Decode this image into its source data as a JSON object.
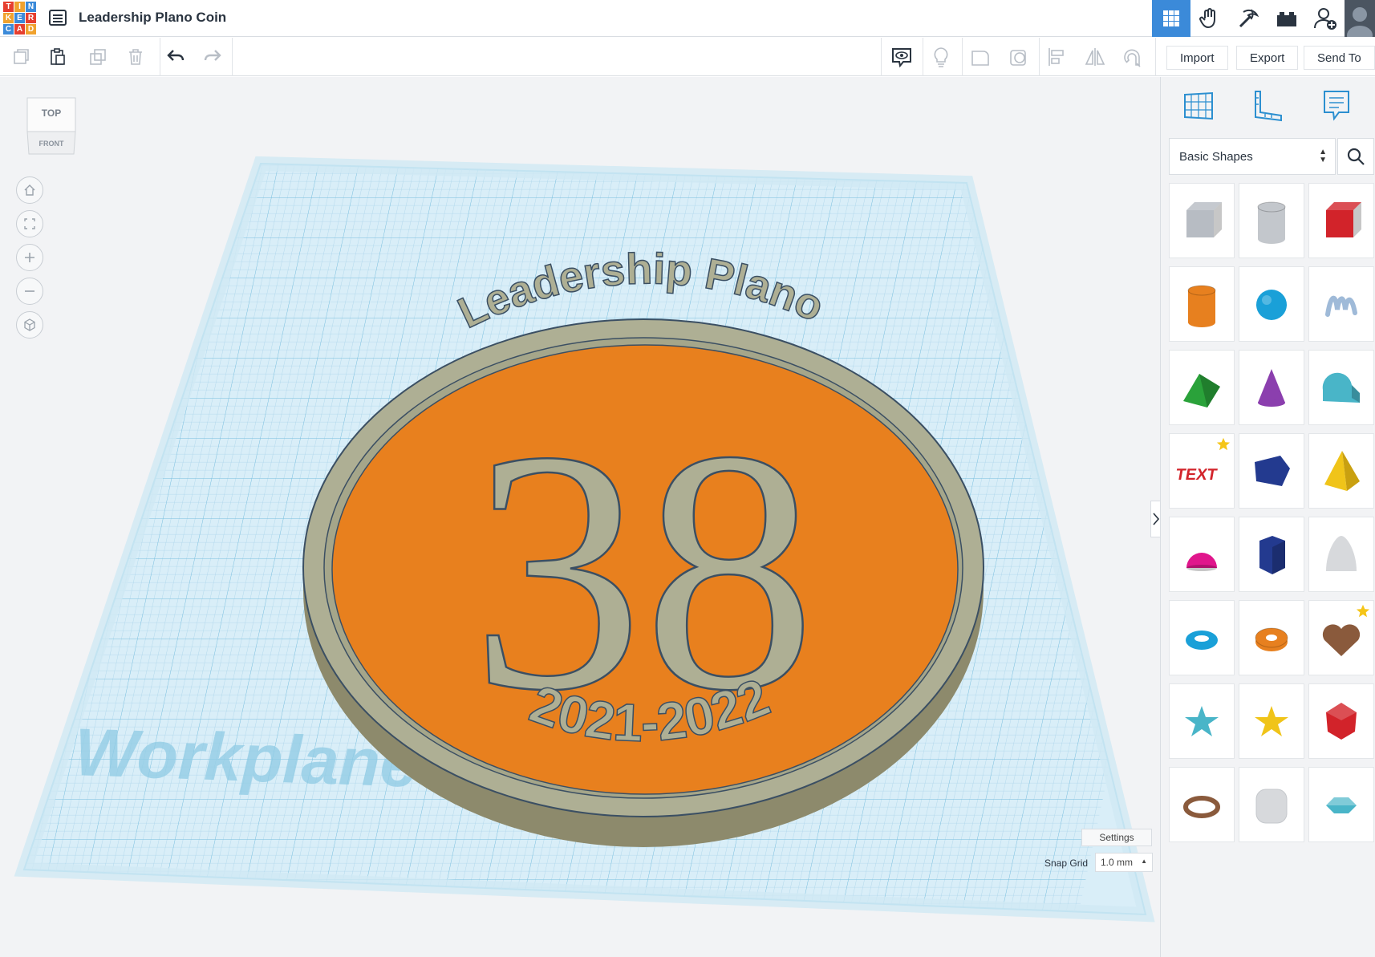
{
  "app": {
    "logo_letters": [
      "T",
      "I",
      "N",
      "K",
      "E",
      "R",
      "C",
      "A",
      "D"
    ],
    "logo_colors": [
      "#e63f2f",
      "#f0a22e",
      "#3b8ad9",
      "#f0a22e",
      "#3b8ad9",
      "#e63f2f",
      "#3b8ad9",
      "#e63f2f",
      "#f0a22e"
    ],
    "document_title": "Leadership Plano Coin"
  },
  "top_nav": {
    "buttons": [
      "3d-design-grid-icon",
      "circuits-hand-icon",
      "codeblocks-pickaxe-icon",
      "bricks-icon",
      "add-user-icon",
      "user-avatar"
    ],
    "active": "3d-design-grid-icon"
  },
  "toolbar": {
    "edit_buttons": [
      "copy-icon",
      "paste-icon",
      "duplicate-icon",
      "delete-icon",
      "undo-icon",
      "redo-icon"
    ],
    "view_buttons": [
      "notes-toggle-icon",
      "light-bulb-icon",
      "shape-icon",
      "hole-icon",
      "align-icon",
      "mirror-icon",
      "group-magnet-icon"
    ],
    "import_label": "Import",
    "export_label": "Export",
    "send_to_label": "Send To"
  },
  "viewcube": {
    "top_label": "TOP",
    "front_label": "FRONT"
  },
  "viewport": {
    "workplane_label": "Workplane",
    "coin": {
      "arc_text": "Leadership Plano",
      "number": "38",
      "years": "2021-2022",
      "face_color": "#e8801e",
      "text_color": "#aeaf94"
    },
    "nav_buttons": [
      "home-icon",
      "fit-view-icon",
      "zoom-in-icon",
      "zoom-out-icon",
      "perspective-icon"
    ],
    "settings_label": "Settings",
    "snap_grid_label": "Snap Grid",
    "snap_grid_value": "1.0 mm"
  },
  "panel": {
    "tabs": [
      "workplane-icon",
      "ruler-icon",
      "notes-icon"
    ],
    "library_label": "Basic Shapes",
    "shapes": [
      {
        "name": "box-hole",
        "color": "#b7bcc3",
        "kind": "box"
      },
      {
        "name": "cylinder-hole",
        "color": "#c3c7cc",
        "kind": "cylinder"
      },
      {
        "name": "box",
        "color": "#d2232a",
        "kind": "box"
      },
      {
        "name": "cylinder",
        "color": "#e7801f",
        "kind": "cylinder"
      },
      {
        "name": "sphere",
        "color": "#1aa0d8",
        "kind": "sphere"
      },
      {
        "name": "scribble",
        "color": "#9fbad8",
        "kind": "scribble"
      },
      {
        "name": "roof",
        "color": "#2aa23a",
        "kind": "roof"
      },
      {
        "name": "cone",
        "color": "#8b3fae",
        "kind": "cone"
      },
      {
        "name": "round-roof",
        "color": "#49b5c8",
        "kind": "roundroof"
      },
      {
        "name": "text",
        "color": "#d2232a",
        "kind": "text",
        "star": true,
        "label": "TEXT"
      },
      {
        "name": "wedge",
        "color": "#233a8f",
        "kind": "wedge"
      },
      {
        "name": "pyramid",
        "color": "#f0c419",
        "kind": "pyramid"
      },
      {
        "name": "half-sphere",
        "color": "#e0168c",
        "kind": "halfsphere"
      },
      {
        "name": "polygon",
        "color": "#233a8f",
        "kind": "polygon"
      },
      {
        "name": "paraboloid",
        "color": "#d7d9dc",
        "kind": "paraboloid"
      },
      {
        "name": "torus",
        "color": "#1aa0d8",
        "kind": "torus"
      },
      {
        "name": "tube",
        "color": "#e7801f",
        "kind": "tube"
      },
      {
        "name": "heart",
        "color": "#8a5a3c",
        "kind": "heart",
        "star": true
      },
      {
        "name": "star",
        "color": "#49b5c8",
        "kind": "star"
      },
      {
        "name": "star-gold",
        "color": "#f0c419",
        "kind": "star"
      },
      {
        "name": "icosahedron",
        "color": "#d2232a",
        "kind": "gem"
      },
      {
        "name": "ring",
        "color": "#8a5a3c",
        "kind": "ring"
      },
      {
        "name": "rounded-box",
        "color": "#d7d9dc",
        "kind": "roundbox"
      },
      {
        "name": "diamond",
        "color": "#49b5c8",
        "kind": "diamond"
      }
    ]
  }
}
